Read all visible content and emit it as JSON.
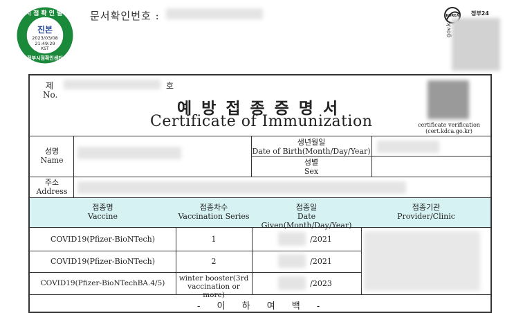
{
  "stamp": {
    "top_text": "시점확인필",
    "center_label": "진본",
    "date": "2023/03/08",
    "time": "21:49:29",
    "tz": "KST",
    "bottom_text": "정부시점확인센터"
  },
  "document_number_label": "문서확인번호 :",
  "gov_logo": {
    "korea_badge": "KOREA",
    "brand": "정부24",
    "side_text": "gov.kr"
  },
  "certificate": {
    "number_prefix_ko": "제",
    "number_suffix_ko": "호",
    "number_label_en": "No.",
    "title_ko": "예방접종증명서",
    "title_en": "Certificate of Immunization",
    "verification_line1": "certificate verification",
    "verification_line2": "(cert.kdca.go.kr)",
    "name_label_ko": "성명",
    "name_label_en": "Name",
    "dob_label_ko": "생년월일",
    "dob_label_en": "Date of Birth(Month/Day/Year)",
    "sex_label_ko": "성별",
    "sex_label_en": "Sex",
    "address_label_ko": "주소",
    "address_label_en": "Address",
    "columns": [
      {
        "ko": "접종명",
        "en": "Vaccine"
      },
      {
        "ko": "접종차수",
        "en": "Vaccination Series"
      },
      {
        "ko": "접종일",
        "en": "Date Given(Month/Day/Year)"
      },
      {
        "ko": "접종기관",
        "en": "Provider/Clinic"
      }
    ],
    "rows": [
      {
        "vaccine": "COVID19(Pfizer-BioNTech)",
        "series": "1",
        "series2": "",
        "date": "/2021"
      },
      {
        "vaccine": "COVID19(Pfizer-BioNTech)",
        "series": "2",
        "series2": "",
        "date": "/2021"
      },
      {
        "vaccine": "COVID19(Pfizer-BioNTechBA.4/5)",
        "series": "winter booster(3rd",
        "series2": "vaccination or more)",
        "date": "/2023"
      }
    ],
    "end_marker": "- 이 하 여 백 -"
  },
  "colors": {
    "header_band": "#d6f2f3",
    "stamp_green": "#1a8a3a",
    "stamp_blue": "#2a4a9a",
    "border": "#333333"
  }
}
